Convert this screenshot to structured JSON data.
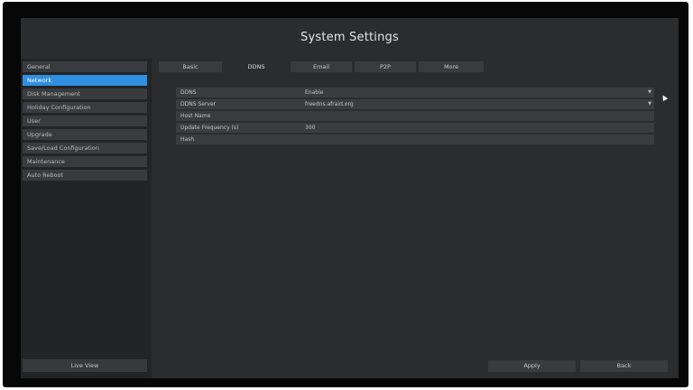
{
  "window": {
    "title": "System Settings"
  },
  "sidebar": {
    "items": [
      {
        "label": "General",
        "active": false
      },
      {
        "label": "Network",
        "active": true
      },
      {
        "label": "Disk Management",
        "active": false
      },
      {
        "label": "Holiday Configuration",
        "active": false
      },
      {
        "label": "User",
        "active": false
      },
      {
        "label": "Upgrade",
        "active": false
      },
      {
        "label": "Save/Load Configuration",
        "active": false
      },
      {
        "label": "Maintenance",
        "active": false
      },
      {
        "label": "Auto Reboot",
        "active": false
      }
    ],
    "live_view_label": "Live View"
  },
  "tabs": [
    {
      "label": "Basic",
      "active": false
    },
    {
      "label": "DDNS",
      "active": true
    },
    {
      "label": "Email",
      "active": false
    },
    {
      "label": "P2P",
      "active": false
    },
    {
      "label": "More",
      "active": false
    }
  ],
  "form": {
    "rows": [
      {
        "label": "DDNS",
        "value": "Enable",
        "dropdown": true
      },
      {
        "label": "DDNS Server",
        "value": "freedns.afraid.org",
        "dropdown": true
      },
      {
        "label": "Host Name",
        "value": "",
        "dropdown": false
      },
      {
        "label": "Update Frequency (s)",
        "value": "300",
        "dropdown": false
      },
      {
        "label": "Hash",
        "value": "",
        "dropdown": false
      }
    ]
  },
  "footer": {
    "apply_label": "Apply",
    "back_label": "Back"
  },
  "colors": {
    "accent": "#2f8fe0",
    "panel": "#2b2c2e",
    "bezel": "#070707"
  }
}
